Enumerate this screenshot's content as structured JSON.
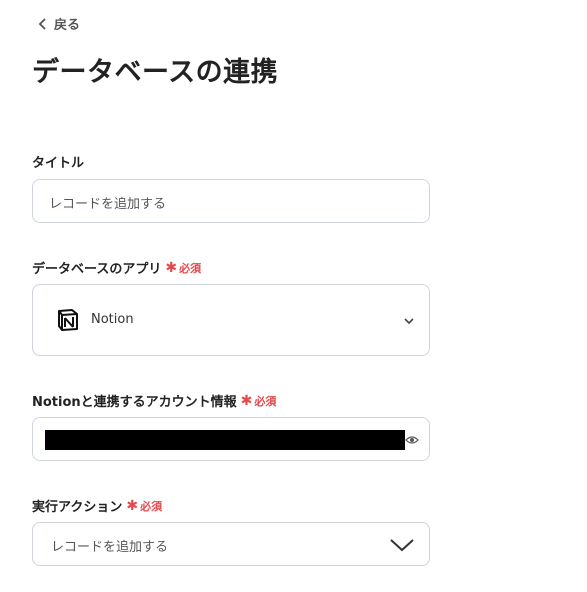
{
  "nav": {
    "back_label": "戻る"
  },
  "page": {
    "title": "データベースの連携"
  },
  "required_label": "必須",
  "fields": {
    "title": {
      "label": "タイトル",
      "value": "レコードを追加する"
    },
    "database_app": {
      "label": "データベースのアプリ",
      "value": "Notion",
      "icon": "notion-icon"
    },
    "account": {
      "label": "Notionと連携するアカウント情報",
      "value": ""
    },
    "action": {
      "label": "実行アクション",
      "value": "レコードを追加する"
    }
  }
}
